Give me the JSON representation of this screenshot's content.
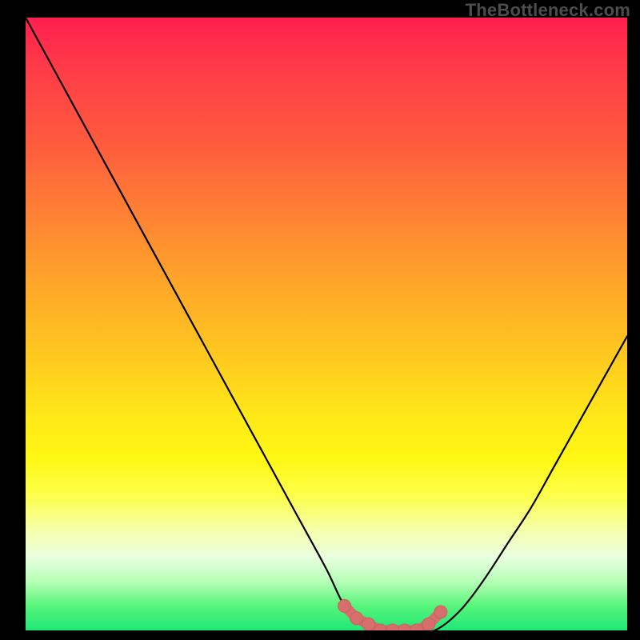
{
  "attribution": "TheBottleneck.com",
  "colors": {
    "page_bg": "#000000",
    "curve_stroke": "#000000",
    "marker_fill": "#d86d6d",
    "marker_stroke": "#c95f5f"
  },
  "chart_data": {
    "type": "line",
    "title": "",
    "xlabel": "",
    "ylabel": "",
    "xlim": [
      0,
      100
    ],
    "ylim": [
      0,
      100
    ],
    "series": [
      {
        "name": "bottleneck-curve",
        "x": [
          0,
          5,
          10,
          15,
          20,
          25,
          30,
          35,
          40,
          45,
          50,
          53,
          56,
          59,
          62,
          65,
          68,
          72,
          76,
          80,
          84,
          88,
          92,
          96,
          100
        ],
        "values": [
          100,
          91,
          82,
          73,
          64,
          55,
          46,
          37,
          28,
          19,
          10,
          4,
          1,
          0,
          0,
          0,
          0,
          3,
          8,
          14,
          20,
          27,
          34,
          41,
          48
        ]
      }
    ],
    "markers": {
      "name": "optimal-range",
      "x": [
        53,
        55,
        57,
        59,
        61,
        63,
        65,
        67,
        69
      ],
      "values": [
        4,
        2,
        1,
        0,
        0,
        0,
        0,
        1,
        3
      ]
    }
  }
}
